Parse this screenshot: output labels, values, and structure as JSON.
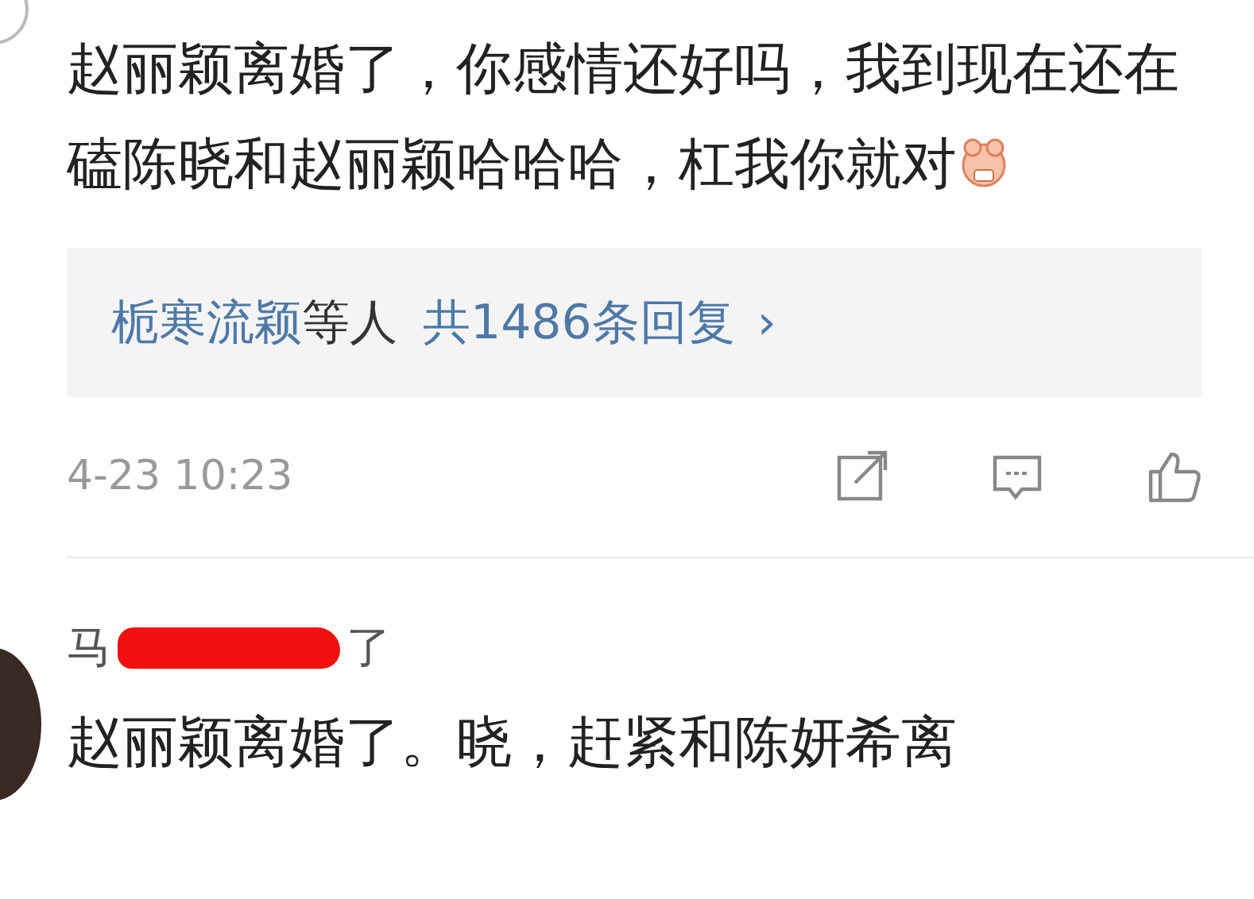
{
  "comments": [
    {
      "text": "赵丽颖离婚了，你感情还好吗，我到现在还在磕陈晓和赵丽颖哈哈哈，杠我你就对",
      "trailing_emoji": true,
      "replies": {
        "users": "栀寒流颖",
        "suffix": "等人",
        "count": "共1486条回复",
        "chevron": "›"
      },
      "time": "4-23 10:23"
    },
    {
      "username": {
        "start": "马",
        "end": "了",
        "redacted": true
      },
      "text": "赵丽颖离婚了。晓，赶紧和陈妍希离"
    }
  ]
}
